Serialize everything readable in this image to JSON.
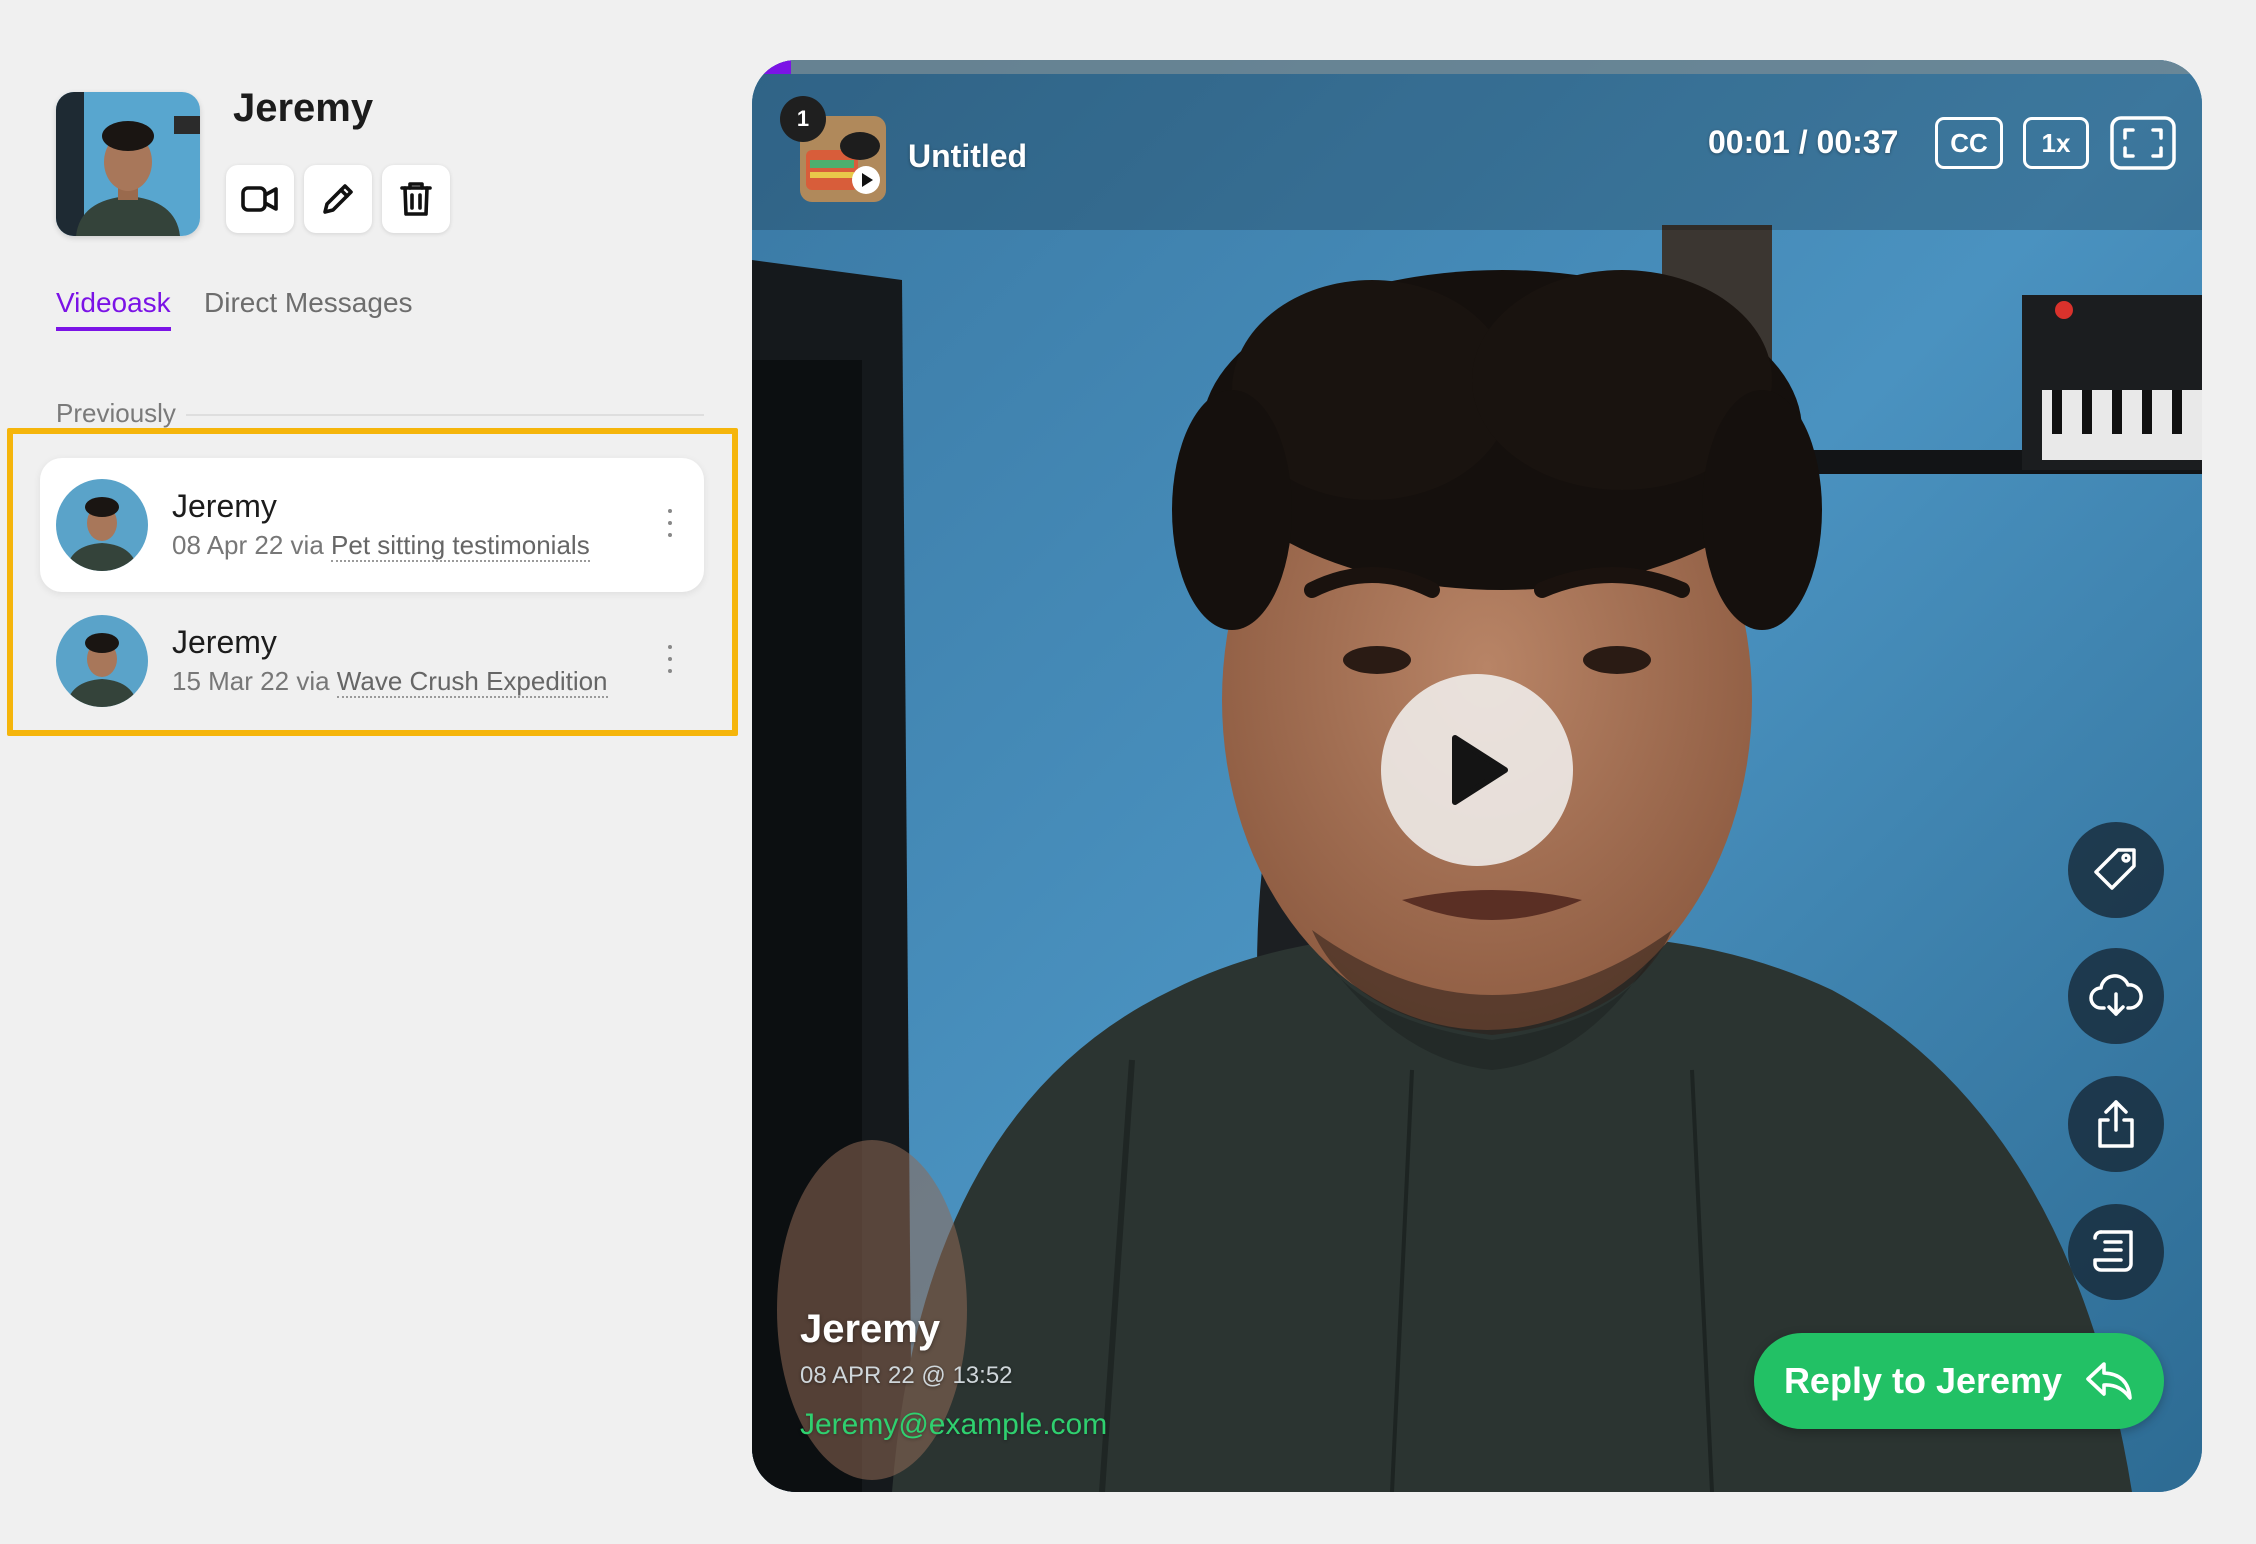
{
  "contact": {
    "name": "Jeremy",
    "actions": [
      {
        "label": "Record video",
        "icon": "video-camera-icon"
      },
      {
        "label": "Edit",
        "icon": "pencil-icon"
      },
      {
        "label": "Delete",
        "icon": "trash-icon"
      }
    ]
  },
  "tabs": [
    {
      "label": "Videoask",
      "active": true
    },
    {
      "label": "Direct Messages",
      "active": false
    }
  ],
  "section_label": "Previously",
  "conversations": [
    {
      "name": "Jeremy",
      "date": "08 Apr 22",
      "via": "via",
      "source": "Pet sitting testimonials",
      "selected": true
    },
    {
      "name": "Jeremy",
      "date": "15 Mar 22",
      "via": "via",
      "source": "Wave Crush Expedition",
      "selected": false
    }
  ],
  "player": {
    "step_number": "1",
    "step_title": "Untitled",
    "time": "00:01 / 00:37",
    "progress_fraction": 0.027,
    "cc_label": "CC",
    "speed_label": "1x",
    "fullscreen_icon": "fullscreen-icon",
    "play_icon": "play-icon",
    "side_actions": [
      {
        "icon": "tag-icon"
      },
      {
        "icon": "cloud-download-icon"
      },
      {
        "icon": "share-icon"
      },
      {
        "icon": "transcript-icon"
      }
    ],
    "respondent_name": "Jeremy",
    "respondent_date": "08 APR 22 @ 13:52",
    "respondent_email": "Jeremy@example.com",
    "reply_label": "Reply to Jeremy",
    "reply_icon": "reply-arrow-icon"
  },
  "colors": {
    "accent_purple": "#7b13e6",
    "highlight_yellow": "#f5b50b",
    "reply_green": "#22c165",
    "email_green": "#2fd06f"
  }
}
